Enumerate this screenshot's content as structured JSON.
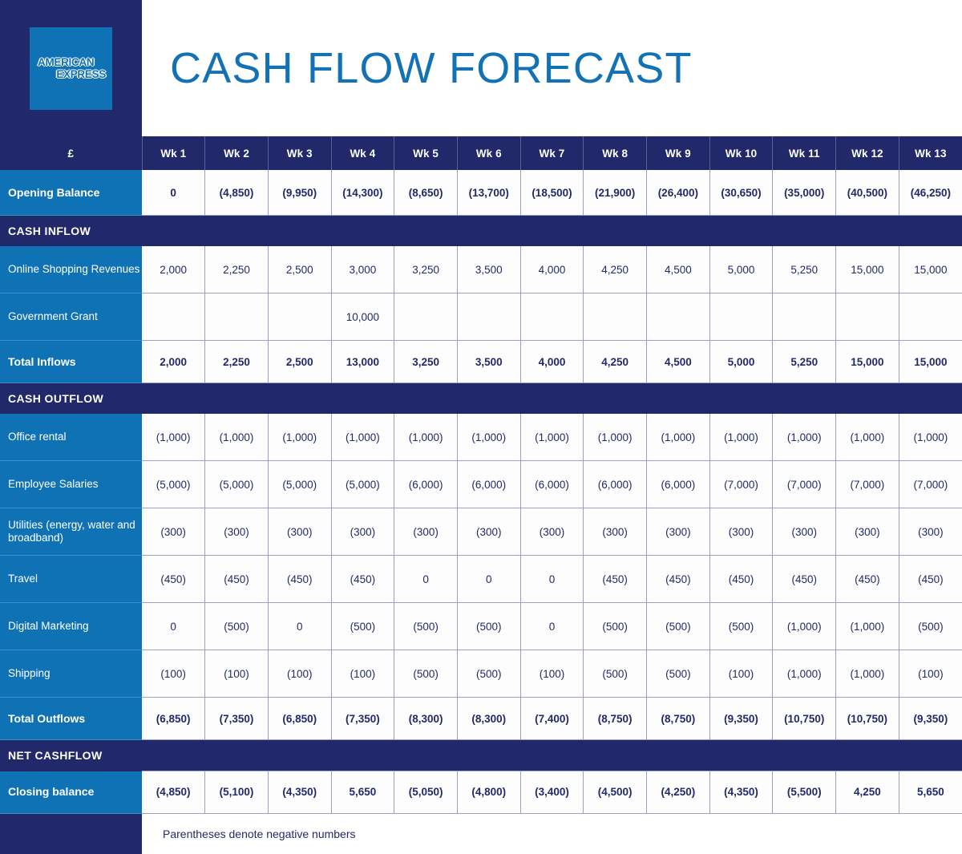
{
  "header": {
    "logo_line_1": "AMERICAN",
    "logo_line_2": "EXPRESS",
    "logo_name": "american-express-logo",
    "title": "CASH FLOW FORECAST",
    "title_color": "#1272b5",
    "pane_color": "#22296b"
  },
  "colors": {
    "navy": "#22296b",
    "blue": "#0f72b5",
    "title_blue": "#1272b5",
    "cell_bg": "#fdfdfd",
    "grid_line": "#9aa0c4"
  },
  "table": {
    "corner_label": "£",
    "week_headers": [
      "Wk 1",
      "Wk 2",
      "Wk 3",
      "Wk 4",
      "Wk 5",
      "Wk 6",
      "Wk 7",
      "Wk 8",
      "Wk 9",
      "Wk 10",
      "Wk 11",
      "Wk 12",
      "Wk 13"
    ],
    "opening": {
      "label": "Opening Balance",
      "values": [
        "0",
        "(4,850)",
        "(9,950)",
        "(14,300)",
        "(8,650)",
        "(13,700)",
        "(18,500)",
        "(21,900)",
        "(26,400)",
        "(30,650)",
        "(35,000)",
        "(40,500)",
        "(46,250)"
      ]
    },
    "band_inflow": "CASH INFLOW",
    "inflow_rows": [
      {
        "label": "Online Shopping Revenues",
        "values": [
          "2,000",
          "2,250",
          "2,500",
          "3,000",
          "3,250",
          "3,500",
          "4,000",
          "4,250",
          "4,500",
          "5,000",
          "5,250",
          "15,000",
          "15,000"
        ]
      },
      {
        "label": "Government Grant",
        "values": [
          "",
          "",
          "",
          "10,000",
          "",
          "",
          "",
          "",
          "",
          "",
          "",
          "",
          ""
        ]
      }
    ],
    "total_inflows": {
      "label": "Total Inflows",
      "values": [
        "2,000",
        "2,250",
        "2,500",
        "13,000",
        "3,250",
        "3,500",
        "4,000",
        "4,250",
        "4,500",
        "5,000",
        "5,250",
        "15,000",
        "15,000"
      ]
    },
    "band_outflow": "CASH OUTFLOW",
    "outflow_rows": [
      {
        "label": "Office rental",
        "values": [
          "(1,000)",
          "(1,000)",
          "(1,000)",
          "(1,000)",
          "(1,000)",
          "(1,000)",
          "(1,000)",
          "(1,000)",
          "(1,000)",
          "(1,000)",
          "(1,000)",
          "(1,000)",
          "(1,000)"
        ]
      },
      {
        "label": "Employee Salaries",
        "values": [
          "(5,000)",
          "(5,000)",
          "(5,000)",
          "(5,000)",
          "(6,000)",
          "(6,000)",
          "(6,000)",
          "(6,000)",
          "(6,000)",
          "(7,000)",
          "(7,000)",
          "(7,000)",
          "(7,000)"
        ]
      },
      {
        "label": "Utilities (energy, water and broadband)",
        "values": [
          "(300)",
          "(300)",
          "(300)",
          "(300)",
          "(300)",
          "(300)",
          "(300)",
          "(300)",
          "(300)",
          "(300)",
          "(300)",
          "(300)",
          "(300)"
        ]
      },
      {
        "label": "Travel",
        "values": [
          "(450)",
          "(450)",
          "(450)",
          "(450)",
          "0",
          "0",
          "0",
          "(450)",
          "(450)",
          "(450)",
          "(450)",
          "(450)",
          "(450)"
        ]
      },
      {
        "label": "Digital Marketing",
        "values": [
          "0",
          "(500)",
          "0",
          "(500)",
          "(500)",
          "(500)",
          "0",
          "(500)",
          "(500)",
          "(500)",
          "(1,000)",
          "(1,000)",
          "(500)"
        ]
      },
      {
        "label": "Shipping",
        "values": [
          "(100)",
          "(100)",
          "(100)",
          "(100)",
          "(500)",
          "(500)",
          "(100)",
          "(500)",
          "(500)",
          "(100)",
          "(1,000)",
          "(1,000)",
          "(100)"
        ]
      }
    ],
    "total_outflows": {
      "label": "Total Outflows",
      "values": [
        "(6,850)",
        "(7,350)",
        "(6,850)",
        "(7,350)",
        "(8,300)",
        "(8,300)",
        "(7,400)",
        "(8,750)",
        "(8,750)",
        "(9,350)",
        "(10,750)",
        "(10,750)",
        "(9,350)"
      ]
    },
    "band_net": "NET CASHFLOW",
    "closing": {
      "label": "Closing balance",
      "values": [
        "(4,850)",
        "(5,100)",
        "(4,350)",
        "5,650",
        "(5,050)",
        "(4,800)",
        "(3,400)",
        "(4,500)",
        "(4,250)",
        "(4,350)",
        "(5,500)",
        "4,250",
        "5,650"
      ]
    },
    "footnote": "Parentheses denote negative numbers"
  },
  "chart_data": {
    "type": "table",
    "title": "CASH FLOW FORECAST",
    "categories": [
      "Wk 1",
      "Wk 2",
      "Wk 3",
      "Wk 4",
      "Wk 5",
      "Wk 6",
      "Wk 7",
      "Wk 8",
      "Wk 9",
      "Wk 10",
      "Wk 11",
      "Wk 12",
      "Wk 13"
    ],
    "xlabel": "Week",
    "ylabel": "£",
    "series": [
      {
        "name": "Opening Balance",
        "values": [
          0,
          -4850,
          -9950,
          -14300,
          -8650,
          -13700,
          -18500,
          -21900,
          -26400,
          -30650,
          -35000,
          -40500,
          -46250
        ]
      },
      {
        "name": "Online Shopping Revenues",
        "values": [
          2000,
          2250,
          2500,
          3000,
          3250,
          3500,
          4000,
          4250,
          4500,
          5000,
          5250,
          15000,
          15000
        ]
      },
      {
        "name": "Government Grant",
        "values": [
          null,
          null,
          null,
          10000,
          null,
          null,
          null,
          null,
          null,
          null,
          null,
          null,
          null
        ]
      },
      {
        "name": "Total Inflows",
        "values": [
          2000,
          2250,
          2500,
          13000,
          3250,
          3500,
          4000,
          4250,
          4500,
          5000,
          5250,
          15000,
          15000
        ]
      },
      {
        "name": "Office rental",
        "values": [
          -1000,
          -1000,
          -1000,
          -1000,
          -1000,
          -1000,
          -1000,
          -1000,
          -1000,
          -1000,
          -1000,
          -1000,
          -1000
        ]
      },
      {
        "name": "Employee Salaries",
        "values": [
          -5000,
          -5000,
          -5000,
          -5000,
          -6000,
          -6000,
          -6000,
          -6000,
          -6000,
          -7000,
          -7000,
          -7000,
          -7000
        ]
      },
      {
        "name": "Utilities (energy, water and broadband)",
        "values": [
          -300,
          -300,
          -300,
          -300,
          -300,
          -300,
          -300,
          -300,
          -300,
          -300,
          -300,
          -300,
          -300
        ]
      },
      {
        "name": "Travel",
        "values": [
          -450,
          -450,
          -450,
          -450,
          0,
          0,
          0,
          -450,
          -450,
          -450,
          -450,
          -450,
          -450
        ]
      },
      {
        "name": "Digital Marketing",
        "values": [
          0,
          -500,
          0,
          -500,
          -500,
          -500,
          0,
          -500,
          -500,
          -500,
          -1000,
          -1000,
          -500
        ]
      },
      {
        "name": "Shipping",
        "values": [
          -100,
          -100,
          -100,
          -100,
          -500,
          -500,
          -100,
          -500,
          -500,
          -100,
          -1000,
          -1000,
          -100
        ]
      },
      {
        "name": "Total Outflows",
        "values": [
          -6850,
          -7350,
          -6850,
          -7350,
          -8300,
          -8300,
          -7400,
          -8750,
          -8750,
          -9350,
          -10750,
          -10750,
          -9350
        ]
      },
      {
        "name": "Closing balance",
        "values": [
          -4850,
          -5100,
          -4350,
          5650,
          -5050,
          -4800,
          -3400,
          -4500,
          -4250,
          -4350,
          -5500,
          4250,
          5650
        ]
      }
    ],
    "annotations": [
      "Parentheses denote negative numbers"
    ]
  }
}
